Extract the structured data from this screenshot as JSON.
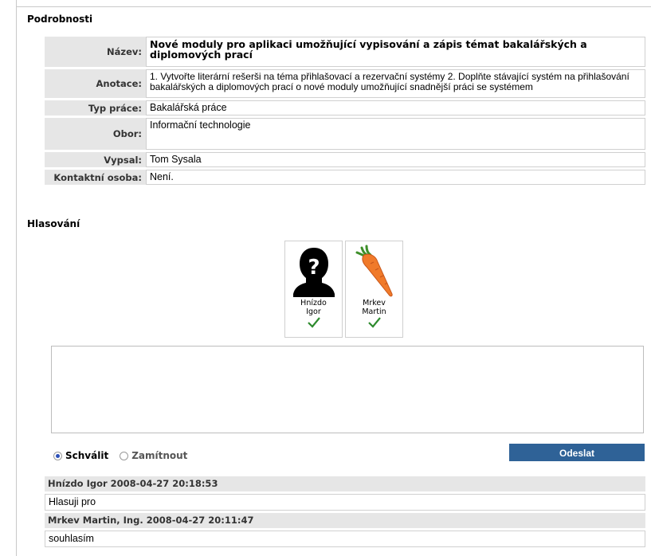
{
  "sections": {
    "details_title": "Podrobnosti",
    "voting_title": "Hlasování"
  },
  "details": [
    {
      "label": "Název:",
      "value": "Nové moduly pro aplikaci umožňující vypisování a zápis témat bakalářských a diplomových prací"
    },
    {
      "label": "Anotace:",
      "value": "1. Vytvořte literární rešerši na téma přihlašovací a rezervační systémy 2. Doplňte stávající systém na přihlašování bakalářských a diplomových prací o nové moduly umožňující snadnější práci se systémem"
    },
    {
      "label": "Typ práce:",
      "value": "Bakalářská práce"
    },
    {
      "label": "Obor:",
      "value": "Informační technologie"
    },
    {
      "label": "Vypsal:",
      "value": "Tom Sysala"
    },
    {
      "label": "Kontaktní osoba:",
      "value": "Není."
    }
  ],
  "voters": [
    {
      "surname": "Hnízdo",
      "firstname": "Igor",
      "avatar": "unknown-person-icon"
    },
    {
      "surname": "Mrkev",
      "firstname": "Martin",
      "avatar": "carrot-icon"
    }
  ],
  "form": {
    "comment_value": "",
    "approve_label": "Schválit",
    "reject_label": "Zamítnout",
    "selected": "approve",
    "send_label": "Odeslat"
  },
  "comments": [
    {
      "header": "Hnízdo Igor   2008-04-27 20:18:53",
      "text": "Hlasuji pro"
    },
    {
      "header": "Mrkev Martin, Ing.   2008-04-27 20:11:47",
      "text": "souhlasím"
    }
  ],
  "colors": {
    "label_bg": "#e6e6e6",
    "button_bg": "#2f6297",
    "check_green": "#2e8b2e"
  }
}
